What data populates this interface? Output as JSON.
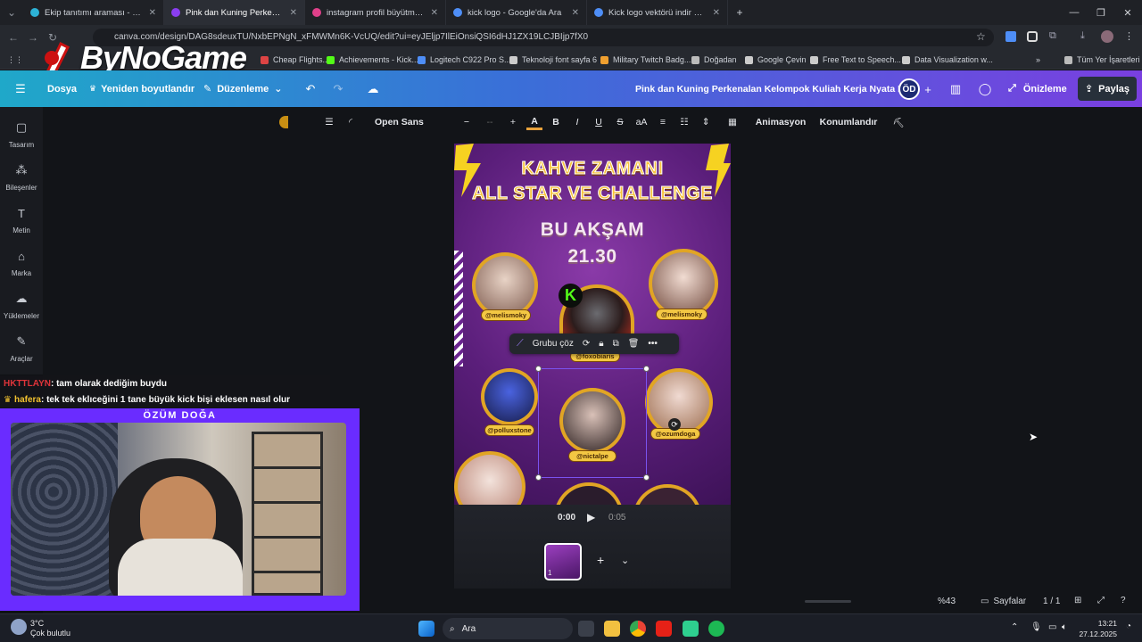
{
  "browser": {
    "tabs": [
      {
        "title": "Ekip tanıtımı araması - Canva",
        "color": "#2db2d6"
      },
      {
        "title": "Pink dan Kuning Perkenalan Ke",
        "color": "#8a3ef0"
      },
      {
        "title": "instagram profil büyütme insta",
        "color": "#e0408a"
      },
      {
        "title": "kick logo - Google'da Ara",
        "color": "#4e8ef7"
      },
      {
        "title": "Kick logo vektörü indir Kick ya",
        "color": "#4e8ef7"
      }
    ],
    "url": "canva.com/design/DAG8sdeuxTU/NxbEPNgN_xFMWMn6K-VcUQ/edit?ui=eyJEljp7IlEiOnsiQSI6dHJ1ZX19LCJBIjp7fX0",
    "bookmarks": [
      {
        "label": "Cheap Flights...",
        "color": "#d44"
      },
      {
        "label": "Achievements - Kick...",
        "color": "#53fc18"
      },
      {
        "label": "Logitech C922 Pro S...",
        "color": "#4e8ef7"
      },
      {
        "label": "Teknoloji font sayfa 6",
        "color": "#ccc"
      },
      {
        "label": "Military Twitch Badg...",
        "color": "#f0a030"
      },
      {
        "label": "Doğadan",
        "color": "#bbb"
      },
      {
        "label": "Google Çevin",
        "color": "#ccc"
      },
      {
        "label": "Free Text to Speech...",
        "color": "#ccc"
      },
      {
        "label": "Data Visualization w...",
        "color": "#ccc"
      },
      {
        "label": "Tüm Yer İşaretleri",
        "color": "#bbb"
      }
    ],
    "logo_text": "ByNoGame"
  },
  "canva": {
    "menu": {
      "file": "Dosya",
      "resize": "Yeniden boyutlandır",
      "edit": "Düzenleme"
    },
    "design_title": "Pink dan Kuning Perkenalan Kelompok Kuliah Kerja Nyata In...",
    "avatar_initials": "ÖD",
    "preview": "Önizleme",
    "share": "Paylaş",
    "sidebar": [
      {
        "label": "Tasarım",
        "icon": "design-icon"
      },
      {
        "label": "Bileşenler",
        "icon": "elements-icon"
      },
      {
        "label": "Metin",
        "icon": "text-icon"
      },
      {
        "label": "Marka",
        "icon": "brand-icon"
      },
      {
        "label": "Yüklemeler",
        "icon": "upload-icon"
      },
      {
        "label": "Araçlar",
        "icon": "tools-icon"
      }
    ],
    "toolbar": {
      "font": "Open Sans",
      "font_size_placeholder": "--",
      "animation": "Animasyon",
      "position": "Konumlandır",
      "case_label": "aA",
      "bold": "B",
      "italic": "I",
      "underline": "U",
      "strike": "S"
    },
    "poster": {
      "line1": "KAHVE ZAMANI",
      "line2": "ALL STAR VE CHALLENGE",
      "line3": "BU AKŞAM",
      "line4": "21.30",
      "kick_letter": "K",
      "handles": [
        "@melismoky",
        "@melismoky",
        "@foxobiaris",
        "@polluxstone",
        "@nictalpe",
        "@ozumdoga"
      ]
    },
    "group_toolbar": {
      "ungroup": "Grubu çöz"
    },
    "audio": {
      "current": "0:00",
      "total": "0:05"
    },
    "page_thumb_label": "1",
    "footer": {
      "zoom": "%43",
      "pages": "Sayfalar",
      "page_count": "1 / 1"
    }
  },
  "stream": {
    "chat": [
      {
        "user": "HKTTLAYN",
        "user_color": "#e0343a",
        "message": ": tam olarak dediğim buydu"
      },
      {
        "user": "hafera",
        "user_color": "#f2c230",
        "message": ": tek tek eklıceğini 1 tane büyük kick bişi eklesen nasıl olur"
      }
    ],
    "cam_title": "ÖZÜM DOĞA"
  },
  "taskbar": {
    "weather_temp": "3°C",
    "weather_desc": "Çok bulutlu",
    "search": "Ara",
    "time": "13:21",
    "date": "27.12.2025"
  }
}
